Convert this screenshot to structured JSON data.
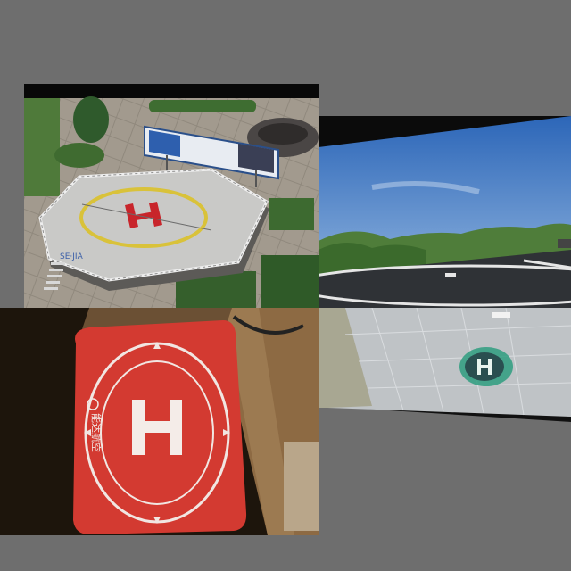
{
  "collage": {
    "tiles": [
      {
        "id": "rooftop-helipad-photo"
      },
      {
        "id": "grass-helipad-photo"
      },
      {
        "id": "red-landing-pad-photo"
      },
      {
        "id": "model-helipad-photo"
      }
    ]
  },
  "helipad_marks": {
    "letter": "H",
    "rooftop_text": "SE·JIA",
    "red_pad_text": "能达航空"
  },
  "colors": {
    "background": "#6e6e6e",
    "pad_red": "#d33a31",
    "helipad_yellow": "#d9c23a",
    "h_red": "#c8252b",
    "sky_blue": "#3f77c4",
    "teal_marker": "#2e9e7f"
  }
}
